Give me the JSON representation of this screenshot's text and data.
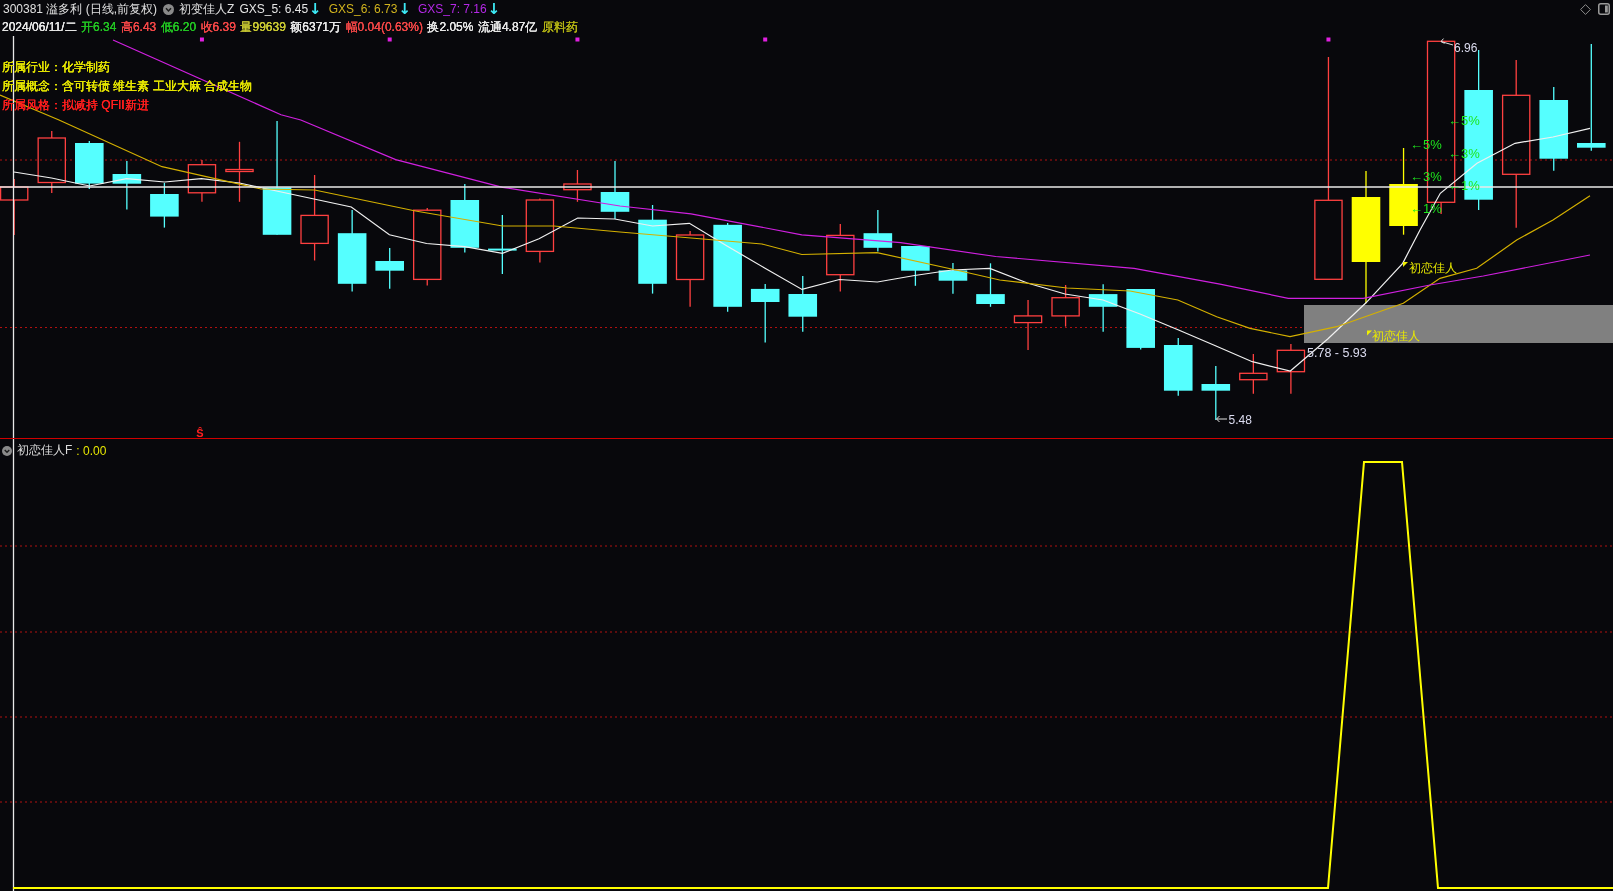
{
  "title_bar": {
    "security": "300381 溢多利 (日线,前复权)",
    "indicator": "初变佳人Z",
    "indicator_values": [
      {
        "label": "GXS_5: 6.45",
        "arrow": "↓",
        "color": "#e6e6e6"
      },
      {
        "label": "GXS_6: 6.73",
        "arrow": "↓",
        "color": "#d2b41e"
      },
      {
        "label": "GXS_7: 7.16",
        "arrow": "↓",
        "color": "#b428e6"
      }
    ]
  },
  "quote_bar": [
    {
      "text": "2024/06/11/二",
      "color": "#e6e6e6"
    },
    {
      "text": "开6.34",
      "color": "#22c322"
    },
    {
      "text": "高6.43",
      "color": "#f04646"
    },
    {
      "text": "低6.20",
      "color": "#22c322"
    },
    {
      "text": "收6.39",
      "color": "#f04646"
    },
    {
      "text": "量99639",
      "color": "#c8c832"
    },
    {
      "text": "额6371万",
      "color": "#e6e6e6"
    },
    {
      "text": "幅0.04(0.63%)",
      "color": "#f04646"
    },
    {
      "text": "换2.05%",
      "color": "#e6e6e6"
    },
    {
      "text": "流通4.87亿",
      "color": "#e6e6e6"
    },
    {
      "text": "原料药",
      "color": "#b4b414"
    }
  ],
  "stock_info": [
    {
      "text": "所属行业：化学制药",
      "color": "#e6e600"
    },
    {
      "text": "所属概念：含可转债 维生素 工业大麻 合成生物",
      "color": "#e6e600"
    },
    {
      "text": "所属风格：拟减持 QFII新进",
      "color": "#ff1e1e"
    }
  ],
  "price_chart": {
    "high_label": "6.96",
    "low_label": "5.48",
    "range_label": "5.78 - 5.93",
    "signal_labels": [
      "初恋佳人",
      "初恋佳人"
    ],
    "target_labels": [
      [
        "←5%",
        "←3%",
        "←1%"
      ],
      [
        "←5%",
        "←3%",
        "←1%"
      ]
    ],
    "sell_mark": "Ŝ"
  },
  "indicator_panel": {
    "name": "初恋佳人F",
    "value": ": 0.00"
  }
}
